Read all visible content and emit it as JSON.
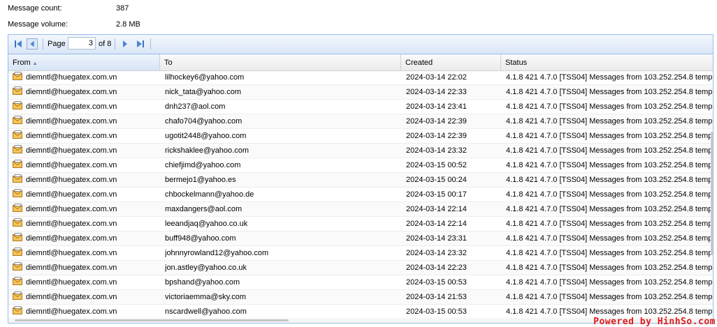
{
  "summary": {
    "message_count_label": "Message count:",
    "message_count_value": "387",
    "message_volume_label": "Message volume:",
    "message_volume_value": "2.8 MB"
  },
  "pager": {
    "page_label": "Page",
    "current_page": "3",
    "of_label": "of 8"
  },
  "columns": {
    "from": "From",
    "to": "To",
    "created": "Created",
    "status": "Status"
  },
  "status_text": "4.1.8 421 4.7.0 [TSS04] Messages from 103.252.254.8 temp",
  "rows": [
    {
      "from": "diemntl@huegatex.com.vn",
      "to": "lilhockey6@yahoo.com",
      "created": "2024-03-14 22:02"
    },
    {
      "from": "diemntl@huegatex.com.vn",
      "to": "nick_tata@yahoo.com",
      "created": "2024-03-14 22:33"
    },
    {
      "from": "diemntl@huegatex.com.vn",
      "to": "dnh237@aol.com",
      "created": "2024-03-14 23:41"
    },
    {
      "from": "diemntl@huegatex.com.vn",
      "to": "chafo704@yahoo.com",
      "created": "2024-03-14 22:39"
    },
    {
      "from": "diemntl@huegatex.com.vn",
      "to": "ugotit2448@yahoo.com",
      "created": "2024-03-14 22:39"
    },
    {
      "from": "diemntl@huegatex.com.vn",
      "to": "rickshaklee@yahoo.com",
      "created": "2024-03-14 23:32"
    },
    {
      "from": "diemntl@huegatex.com.vn",
      "to": "chiefjimd@yahoo.com",
      "created": "2024-03-15 00:52"
    },
    {
      "from": "diemntl@huegatex.com.vn",
      "to": "bermejo1@yahoo.es",
      "created": "2024-03-15 00:24"
    },
    {
      "from": "diemntl@huegatex.com.vn",
      "to": "chbockelmann@yahoo.de",
      "created": "2024-03-15 00:17"
    },
    {
      "from": "diemntl@huegatex.com.vn",
      "to": "maxdangers@aol.com",
      "created": "2024-03-14 22:14"
    },
    {
      "from": "diemntl@huegatex.com.vn",
      "to": "leeandjaq@yahoo.co.uk",
      "created": "2024-03-14 22:14"
    },
    {
      "from": "diemntl@huegatex.com.vn",
      "to": "buff948@yahoo.com",
      "created": "2024-03-14 23:31"
    },
    {
      "from": "diemntl@huegatex.com.vn",
      "to": "johnnyrowland12@yahoo.com",
      "created": "2024-03-14 23:32"
    },
    {
      "from": "diemntl@huegatex.com.vn",
      "to": "jon.astley@yahoo.co.uk",
      "created": "2024-03-14 22:23"
    },
    {
      "from": "diemntl@huegatex.com.vn",
      "to": "bpshand@yahoo.com",
      "created": "2024-03-15 00:53"
    },
    {
      "from": "diemntl@huegatex.com.vn",
      "to": "victoriaemma@sky.com",
      "created": "2024-03-14 21:53"
    },
    {
      "from": "diemntl@huegatex.com.vn",
      "to": "nscardwell@yahoo.com",
      "created": "2024-03-15 00:53"
    }
  ],
  "watermark": "Powered by HinhSo.com"
}
